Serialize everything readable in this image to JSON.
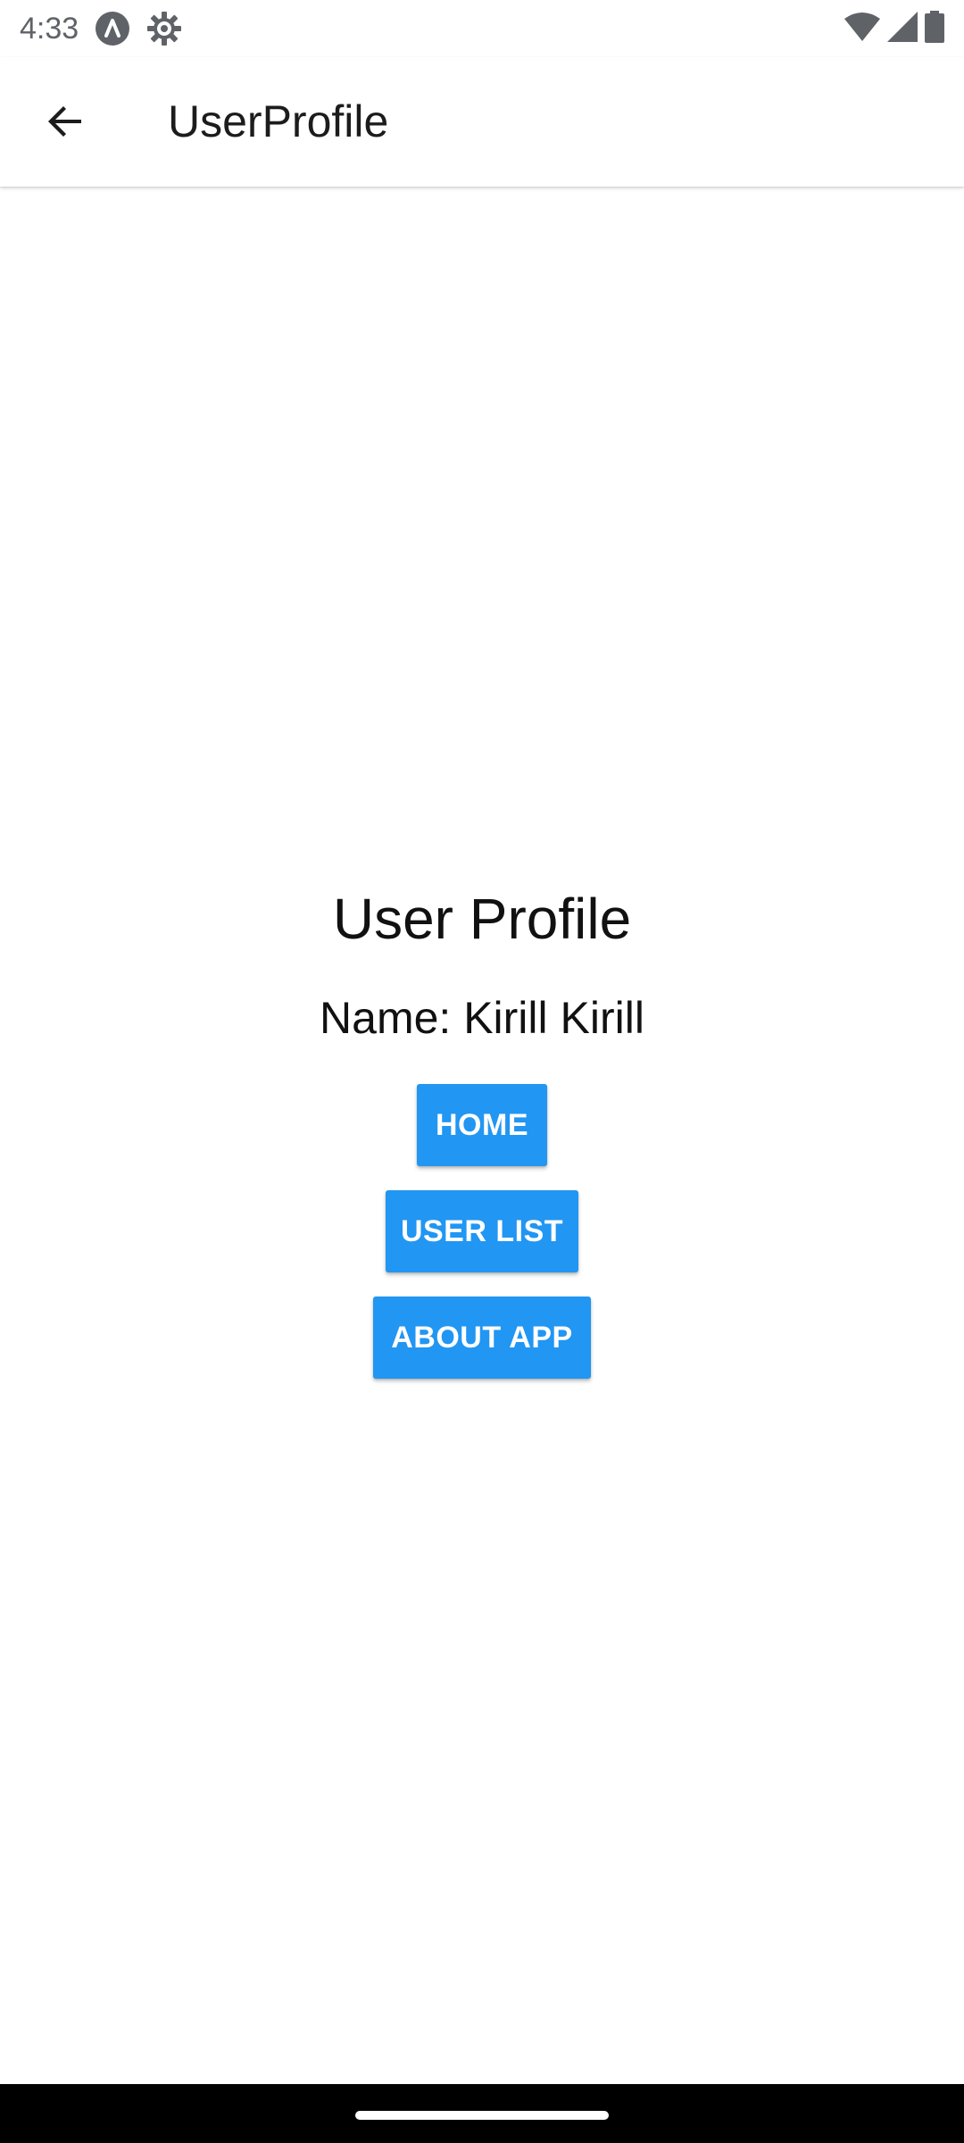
{
  "status_bar": {
    "time": "4:33",
    "icons": [
      "automation-a-icon",
      "settings-gear-icon",
      "wifi-icon",
      "cell-signal-icon",
      "battery-icon"
    ]
  },
  "app_bar": {
    "back_icon": "arrow-back-icon",
    "title": "UserProfile"
  },
  "profile": {
    "heading": "User Profile",
    "name_text": "Name: Kirill Kirill"
  },
  "buttons": {
    "home": "HOME",
    "user_list": "USER LIST",
    "about_app": "ABOUT APP"
  },
  "colors": {
    "button_primary": "#2196f3",
    "button_text": "#ffffff",
    "nav_bar": "#000000"
  }
}
